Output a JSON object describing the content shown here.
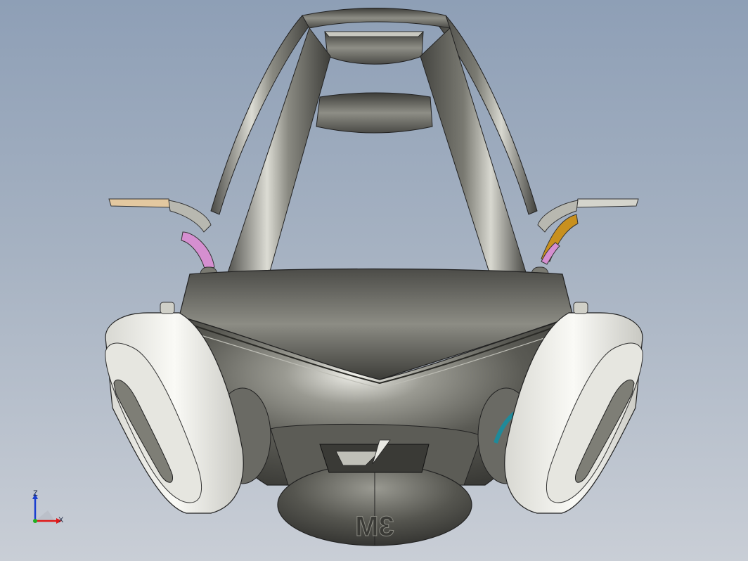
{
  "viewport": {
    "background_top": "#8e9fb6",
    "background_bottom": "#c9ced6"
  },
  "model": {
    "logo_text": "3M",
    "colors": {
      "shell": "#5a5a55",
      "strap": "#6a6a64",
      "cartridge": "#f2f2ee",
      "buckle_pink": "#d58fd0",
      "buckle_orange": "#c8901e",
      "teal_ring": "#1f8a9a",
      "tan_strap": "#e3c8a0"
    }
  },
  "triad": {
    "z_label": "Z",
    "x_label": "X",
    "z_color": "#1a3fd0",
    "x_color": "#e01818",
    "y_color": "#20b020"
  }
}
